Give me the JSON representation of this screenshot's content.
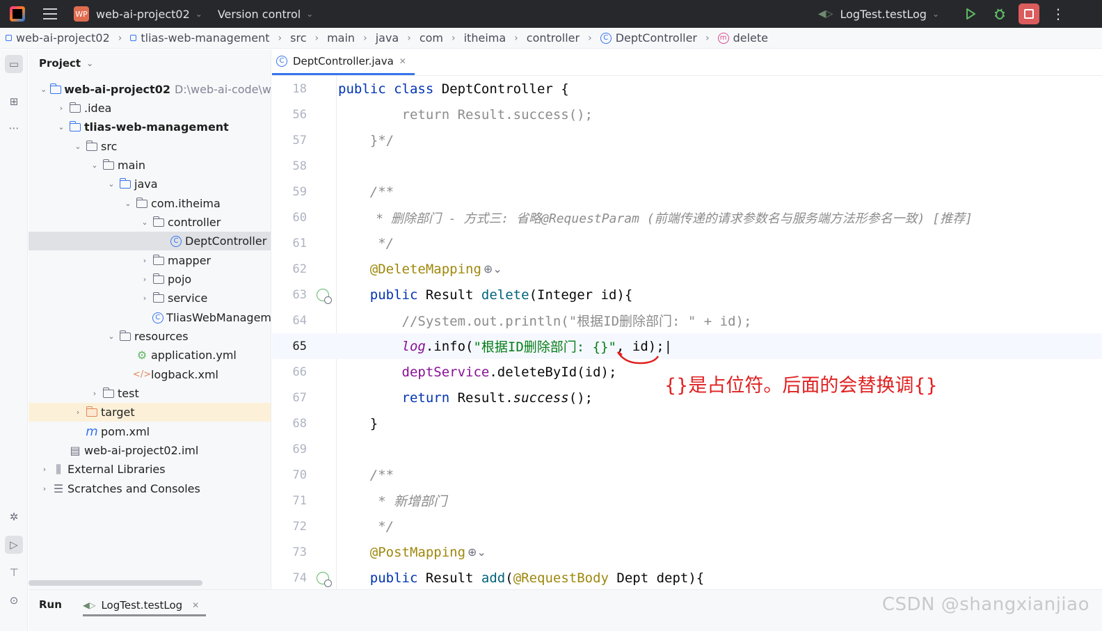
{
  "titlebar": {
    "project_badge": "WP",
    "project_name": "web-ai-project02",
    "vcs_label": "Version control",
    "run_config": "LogTest.testLog"
  },
  "breadcrumb": [
    "web-ai-project02",
    "tlias-web-management",
    "src",
    "main",
    "java",
    "com",
    "itheima",
    "controller",
    "DeptController",
    "delete"
  ],
  "project": {
    "title": "Project",
    "tree": [
      {
        "label": "web-ai-project02",
        "extra": "D:\\web-ai-code\\w",
        "bold": true
      },
      {
        "label": ".idea"
      },
      {
        "label": "tlias-web-management",
        "bold": true
      },
      {
        "label": "src"
      },
      {
        "label": "main"
      },
      {
        "label": "java"
      },
      {
        "label": "com.itheima"
      },
      {
        "label": "controller"
      },
      {
        "label": "DeptController"
      },
      {
        "label": "mapper"
      },
      {
        "label": "pojo"
      },
      {
        "label": "service"
      },
      {
        "label": "TliasWebManagem"
      },
      {
        "label": "resources"
      },
      {
        "label": "application.yml"
      },
      {
        "label": "logback.xml"
      },
      {
        "label": "test"
      },
      {
        "label": "target"
      },
      {
        "label": "pom.xml"
      },
      {
        "label": "web-ai-project02.iml"
      },
      {
        "label": "External Libraries"
      },
      {
        "label": "Scratches and Consoles"
      }
    ]
  },
  "editor": {
    "tab_label": "DeptController.java",
    "lines": [
      {
        "n": "18",
        "a": "public class ",
        "b": "DeptController {"
      },
      {
        "n": "56",
        "a": "        return Result.success();"
      },
      {
        "n": "57",
        "a": "    }*/"
      },
      {
        "n": "58",
        "a": ""
      },
      {
        "n": "59",
        "a": "    /**"
      },
      {
        "n": "60",
        "a": "     * 删除部门 - 方式三: 省略@RequestParam (前端传递的请求参数名与服务端方法形参名一致) [推荐]"
      },
      {
        "n": "61",
        "a": "     */"
      },
      {
        "n": "62",
        "a": "    @DeleteMapping"
      },
      {
        "n": "63",
        "a": "    public ",
        "b": "Result ",
        "c": "delete",
        "d": "(Integer id){"
      },
      {
        "n": "64",
        "a": "        //System.out.println(\"根据ID删除部门: \" + id);"
      },
      {
        "n": "65",
        "a": "        ",
        "b": "log",
        "c": ".info(",
        "d": "\"根据ID删除部门: {}\"",
        "e": ", id);"
      },
      {
        "n": "66",
        "a": "        ",
        "b": "deptService",
        "c": ".deleteById(id);"
      },
      {
        "n": "67",
        "a": "        return ",
        "b": "Result.",
        "c": "success",
        "d": "();"
      },
      {
        "n": "68",
        "a": "    }"
      },
      {
        "n": "69",
        "a": ""
      },
      {
        "n": "70",
        "a": "    /**"
      },
      {
        "n": "71",
        "a": "     * 新增部门"
      },
      {
        "n": "72",
        "a": "     */"
      },
      {
        "n": "73",
        "a": "    @PostMapping"
      },
      {
        "n": "74",
        "a": "    public ",
        "b": "Result ",
        "c": "add",
        "d": "(",
        "e": "@RequestBody ",
        "f": "Dept dept){"
      }
    ],
    "annotation": "{}是占位符。后面的会替换调{}"
  },
  "run_panel": {
    "title": "Run",
    "tab_label": "LogTest.testLog"
  },
  "watermark": "CSDN @shangxianjiao",
  "colors": {
    "keyword": "#0033b3",
    "annotation": "#9e880d",
    "string": "#067d17",
    "comment": "#8c8c8c",
    "note_red": "#e02020"
  }
}
